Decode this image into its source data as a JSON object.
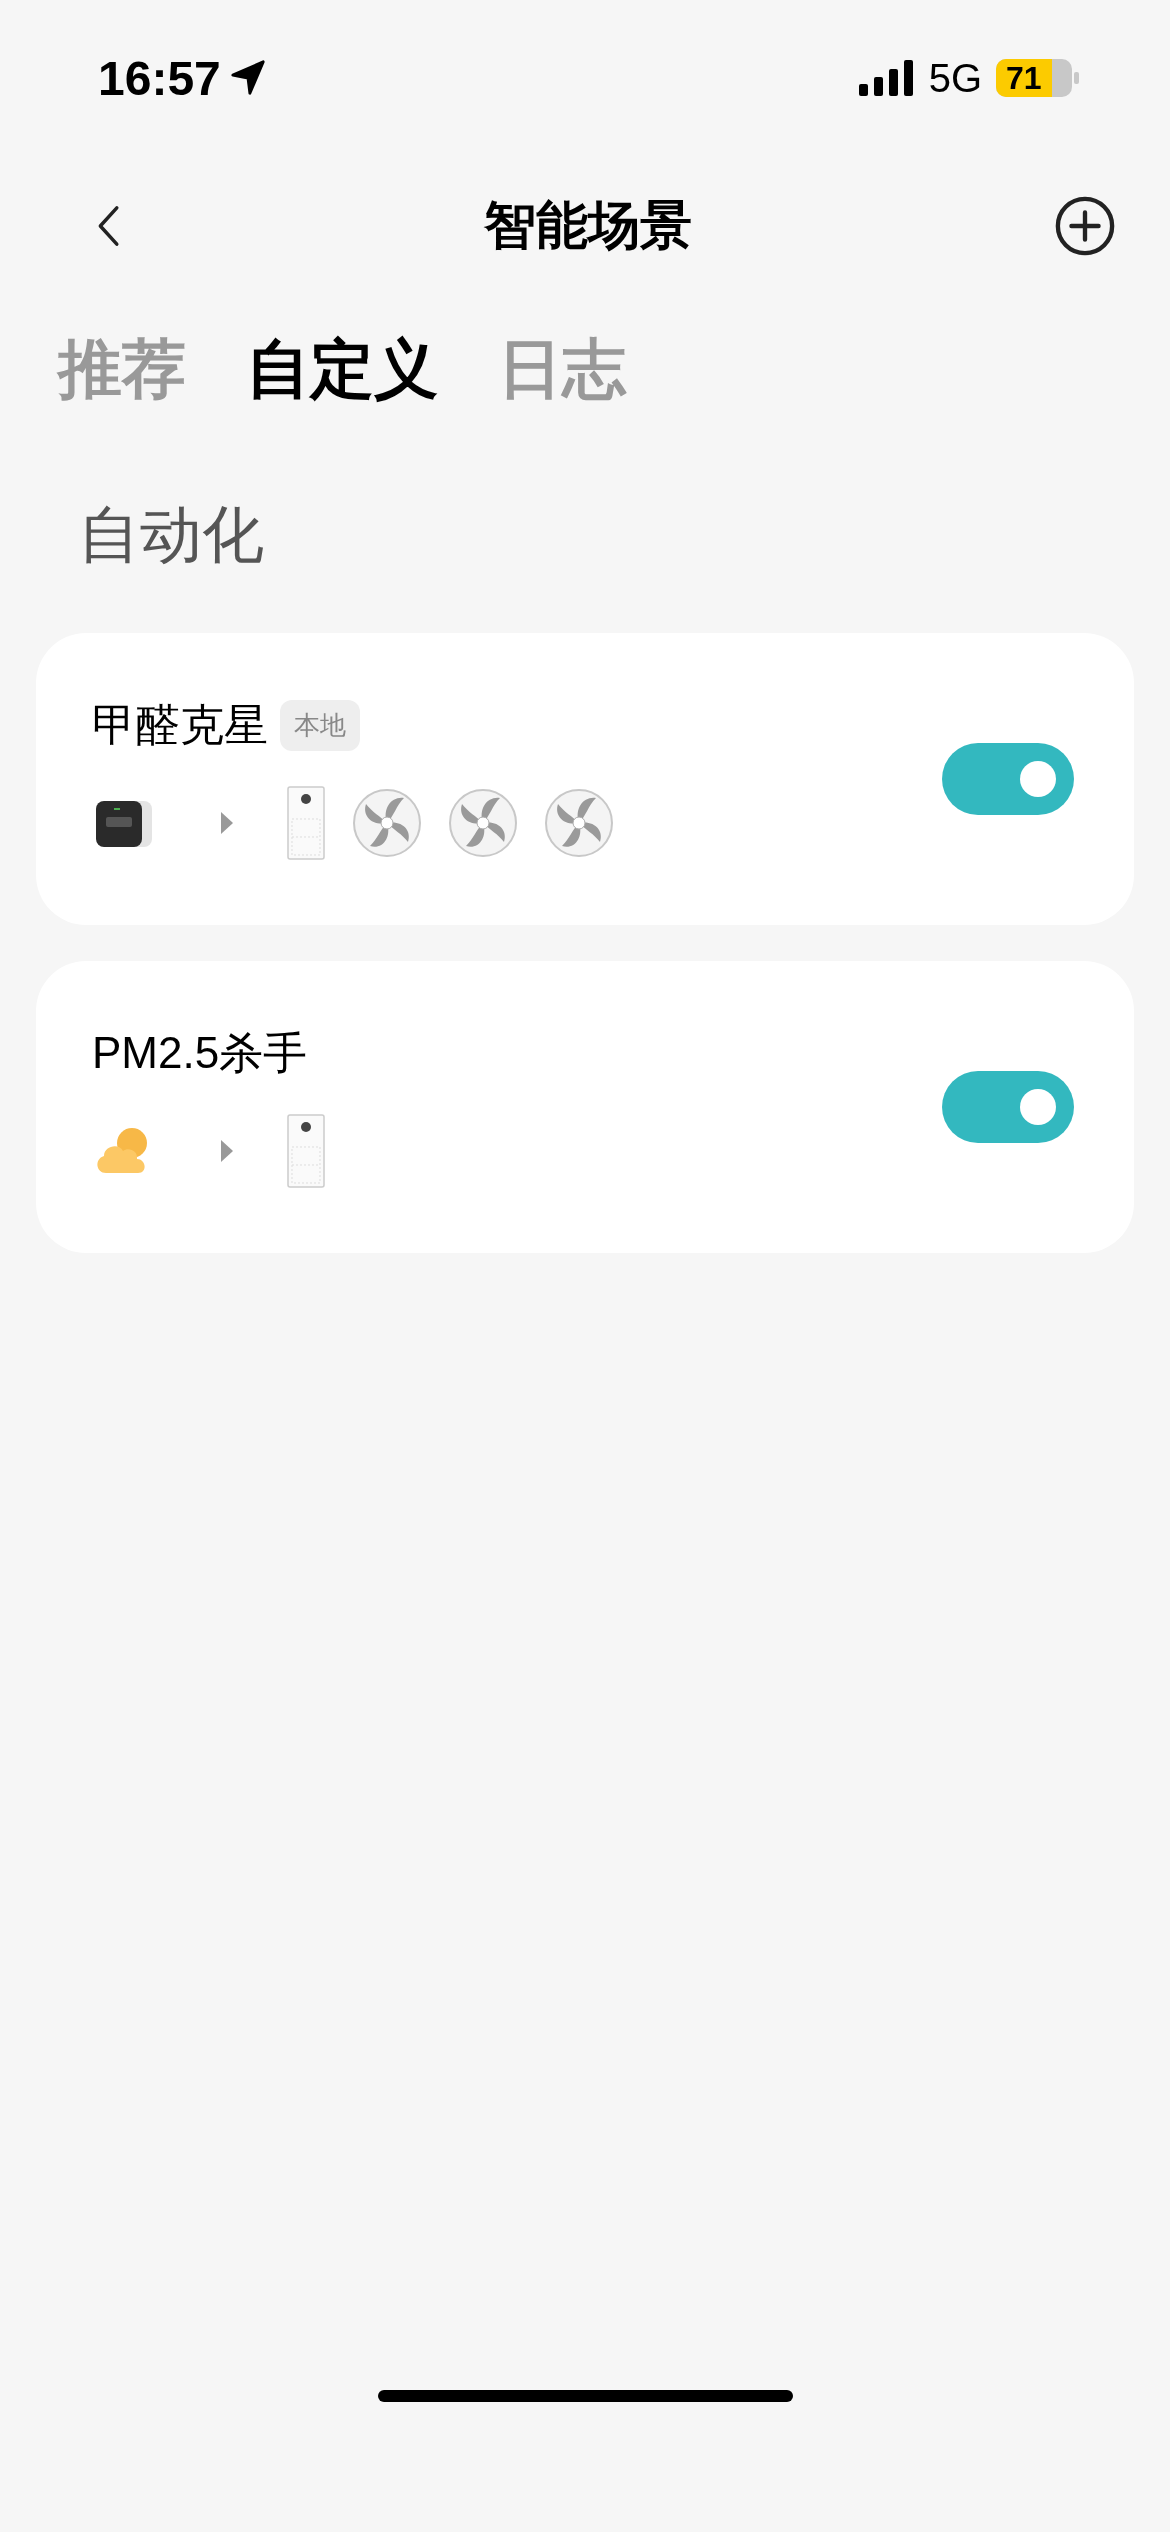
{
  "status_bar": {
    "time": "16:57",
    "network": "5G",
    "battery": "71"
  },
  "nav": {
    "title": "智能场景"
  },
  "tabs": [
    {
      "label": "推荐",
      "selected": false
    },
    {
      "label": "自定义",
      "selected": true
    },
    {
      "label": "日志",
      "selected": false
    }
  ],
  "section_title": "自动化",
  "scenes": [
    {
      "name": "甲醛克星",
      "badge": "本地",
      "enabled": true,
      "triggers": [
        {
          "kind": "sensor"
        }
      ],
      "actions": [
        {
          "kind": "purifier"
        },
        {
          "kind": "fan"
        },
        {
          "kind": "fan"
        },
        {
          "kind": "fan"
        }
      ]
    },
    {
      "name": "PM2.5杀手",
      "enabled": true,
      "triggers": [
        {
          "kind": "weather"
        }
      ],
      "actions": [
        {
          "kind": "purifier"
        }
      ]
    }
  ]
}
